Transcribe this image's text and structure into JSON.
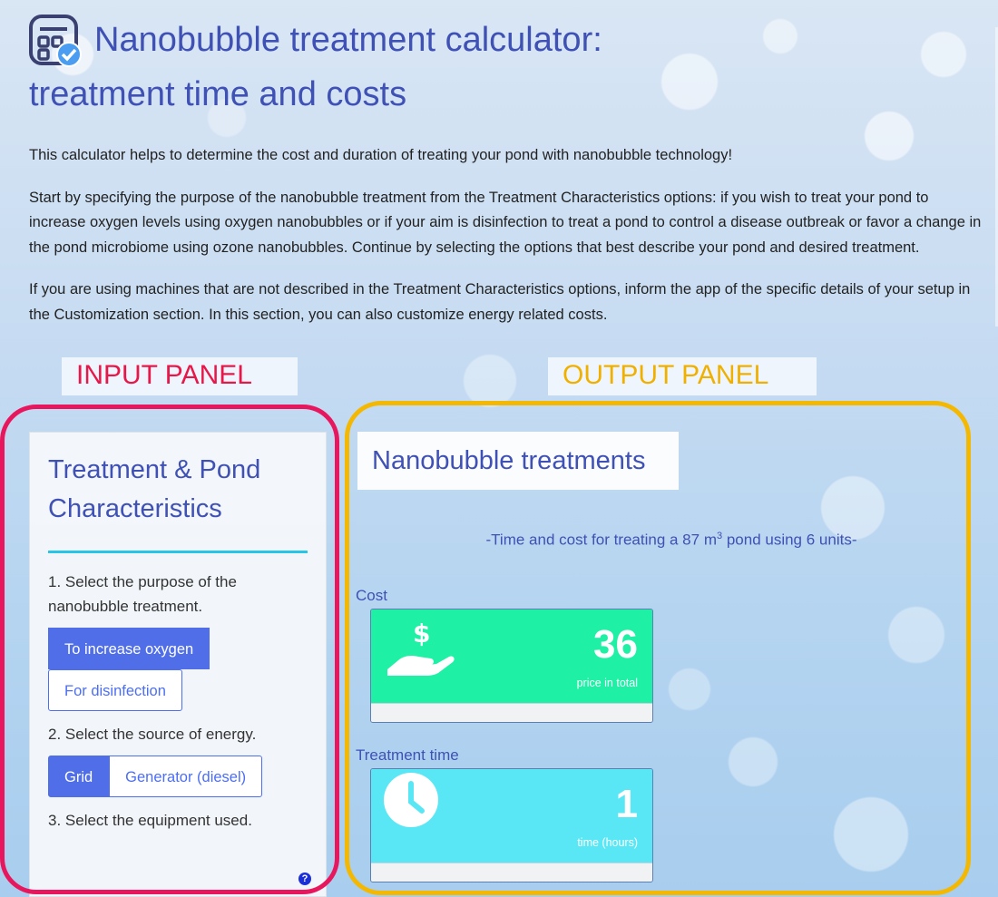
{
  "header": {
    "title_line1": "Nanobubble treatment calculator:",
    "title_line2": "treatment time and costs",
    "icon": "calculator-check-icon"
  },
  "intro": {
    "p1": "This calculator helps to determine the cost and duration of treating your pond with nanobubble technology!",
    "p2": "Start by specifying the purpose of the nanobubble treatment from the Treatment Characteristics options: if you wish to treat your pond to increase oxygen levels using oxygen nanobubbles or if your aim is disinfection to treat a pond to control a disease outbreak or favor a change in the pond microbiome using ozone nanobubbles. Continue by selecting the options that best describe your pond and desired treatment.",
    "p3": "If you are using machines that are not described in the Treatment Characteristics options, inform the app of the specific details of your setup in the Customization section. In this section, you can also customize energy related costs."
  },
  "annotations": {
    "input_label": "INPUT PANEL",
    "output_label": "OUTPUT PANEL",
    "input_color": "#e8175d",
    "output_color": "#f5b800"
  },
  "input_panel": {
    "title": "Treatment & Pond Characteristics",
    "step1": "1. Select the purpose of the nanobubble treatment.",
    "purpose_options": [
      "To increase oxygen",
      "For disinfection"
    ],
    "purpose_selected": "To increase oxygen",
    "step2": "2. Select the source of energy.",
    "energy_options": [
      "Grid",
      "Generator (diesel)"
    ],
    "energy_selected": "Grid",
    "step3": "3. Select the equipment used.",
    "help_icon": "help-icon",
    "help_glyph": "?"
  },
  "output_panel": {
    "title": "Nanobubble treatments",
    "subtitle_prefix": "-Time and cost for treating a 87 m",
    "subtitle_sup": "3",
    "subtitle_suffix": " pond using 6 units-",
    "cost": {
      "label": "Cost",
      "value": "36",
      "unit": "price in total",
      "icon": "hand-dollar-icon",
      "color": "#1ef0a6"
    },
    "time": {
      "label": "Treatment time",
      "value": "1",
      "unit": "time (hours)",
      "icon": "clock-icon",
      "color": "#5ae7f5"
    }
  }
}
